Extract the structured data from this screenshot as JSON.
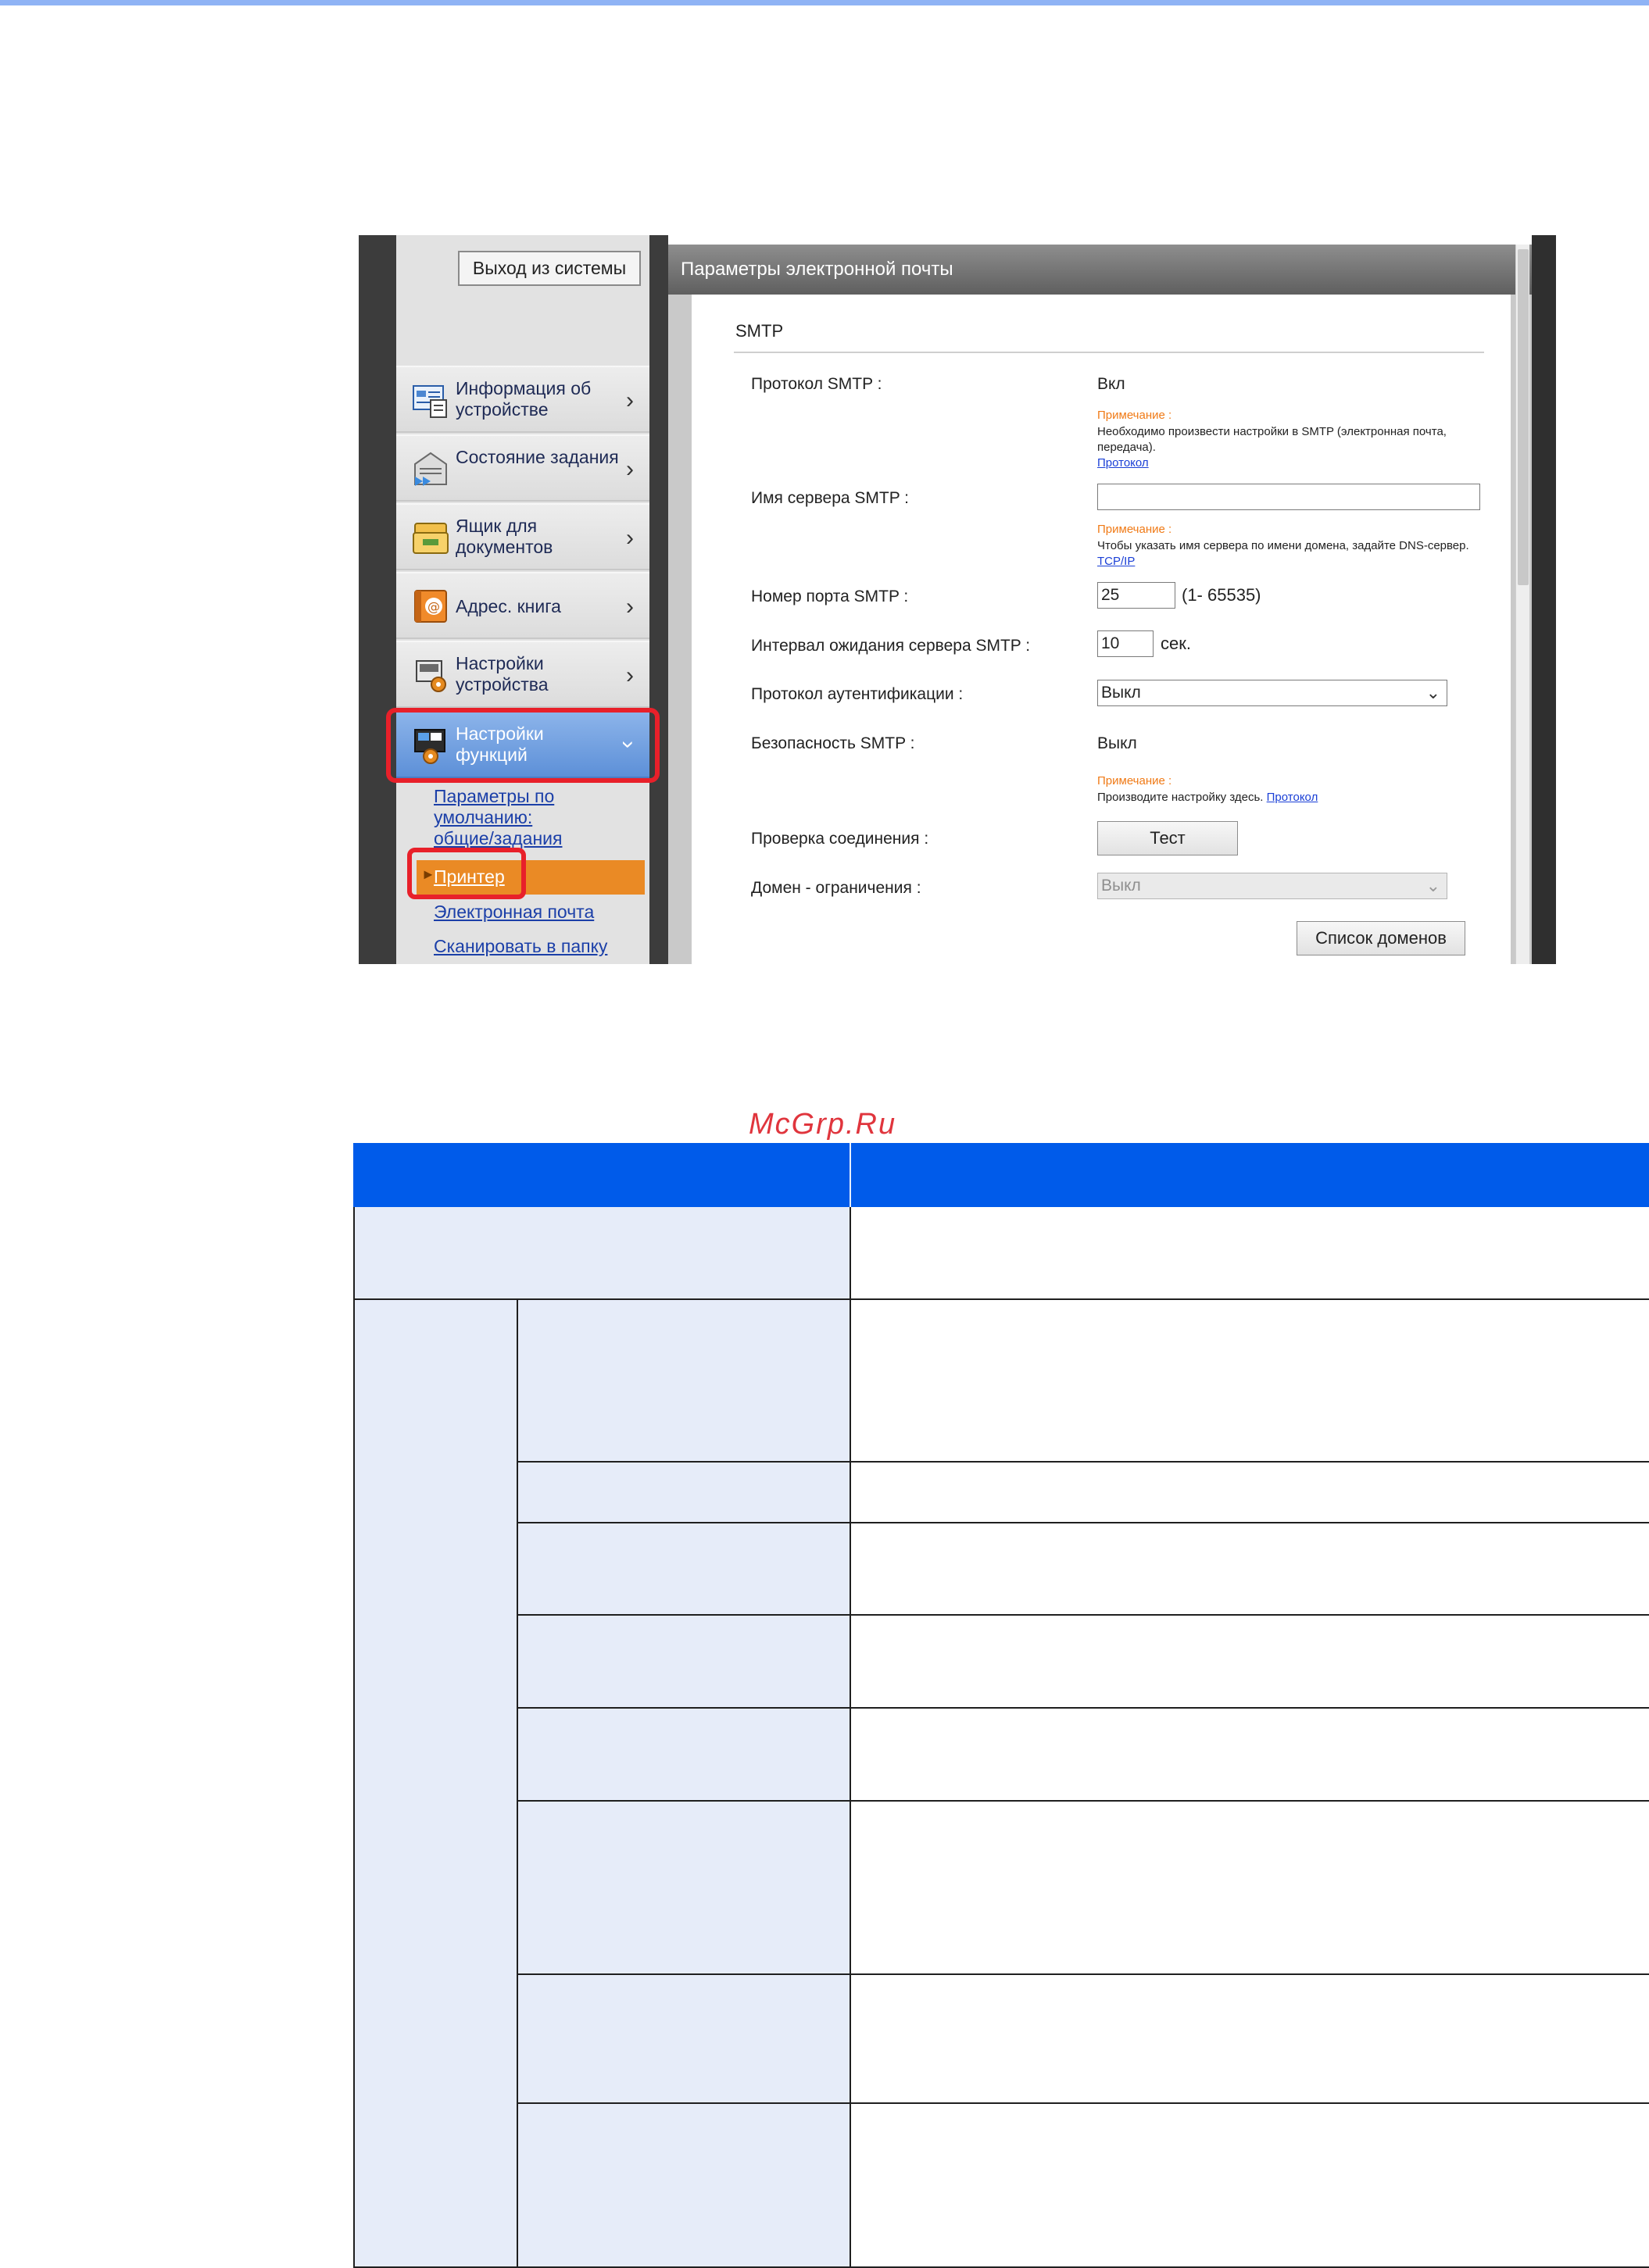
{
  "watermark": "McGrp.Ru",
  "screenshot": {
    "logout_label": "Выход из системы",
    "nav": [
      {
        "label": "Информация об устройстве",
        "icon": "device-info-icon"
      },
      {
        "label": "Состояние задания",
        "icon": "job-status-icon"
      },
      {
        "label": "Ящик для документов",
        "icon": "document-box-icon"
      },
      {
        "label": "Адрес. книга",
        "icon": "address-book-icon"
      },
      {
        "label": "Настройки устройства",
        "icon": "device-settings-icon"
      },
      {
        "label": "Настройки функций",
        "icon": "function-settings-icon",
        "expanded": true
      }
    ],
    "subnav": [
      "Параметры по умолчанию: общие/задания",
      "Принтер",
      "Электронная почта",
      "Сканировать в папку"
    ],
    "panel_title": "Параметры электронной почты",
    "section": "SMTP",
    "fields": {
      "smtp_protocol": {
        "label": "Протокол SMTP :",
        "value": "Вкл"
      },
      "note1": {
        "head": "Примечание :",
        "text": "Необходимо произвести настройки в SMTP (электронная почта, передача).",
        "link": "Протокол"
      },
      "server_name": {
        "label": "Имя сервера SMTP :",
        "value": ""
      },
      "note2": {
        "head": "Примечание :",
        "text": "Чтобы указать имя сервера по имени домена, задайте DNS-сервер.",
        "link": "TCP/IP"
      },
      "port": {
        "label": "Номер порта SMTP :",
        "value": "25",
        "range": "(1- 65535)"
      },
      "timeout": {
        "label": "Интервал ожидания сервера SMTP :",
        "value": "10",
        "unit": "сек."
      },
      "auth": {
        "label": "Протокол аутентификации :",
        "value": "Выкл"
      },
      "security": {
        "label": "Безопасность SMTP :",
        "value": "Выкл"
      },
      "note3": {
        "head": "Примечание :",
        "text": "Производите настройку здесь.",
        "link": "Протокол"
      },
      "conn_test": {
        "label": "Проверка соединения :",
        "button": "Тест"
      },
      "domain": {
        "label": "Домен - ограничения :",
        "value": "Выкл"
      },
      "domain_list_button": "Список доменов"
    }
  },
  "colors": {
    "accent_blue": "#005bea",
    "highlight_red": "#e8202a",
    "printer_orange": "#ea8a25",
    "table_fill": "#e6ecf9"
  }
}
